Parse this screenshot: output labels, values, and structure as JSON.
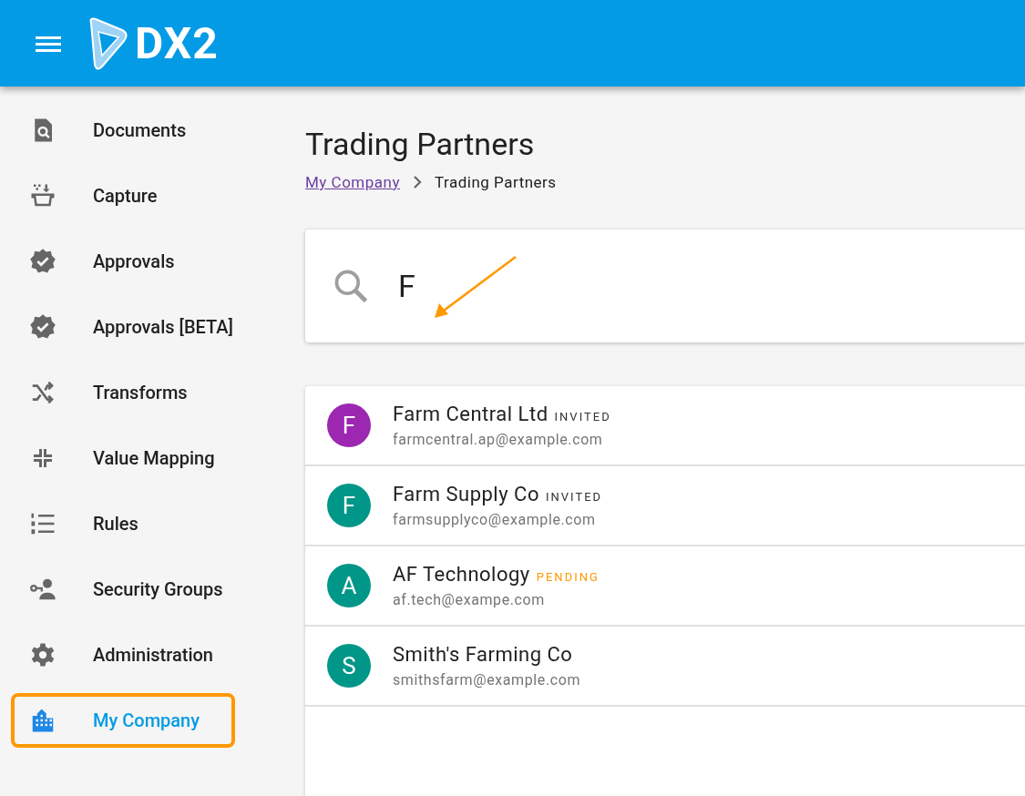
{
  "header": {
    "logo_text": "DX2"
  },
  "sidebar": {
    "items": [
      {
        "label": "Documents",
        "selected": false
      },
      {
        "label": "Capture",
        "selected": false
      },
      {
        "label": "Approvals",
        "selected": false
      },
      {
        "label": "Approvals [BETA]",
        "selected": false
      },
      {
        "label": "Transforms",
        "selected": false
      },
      {
        "label": "Value Mapping",
        "selected": false
      },
      {
        "label": "Rules",
        "selected": false
      },
      {
        "label": "Security Groups",
        "selected": false
      },
      {
        "label": "Administration",
        "selected": false
      },
      {
        "label": "My Company",
        "selected": true
      }
    ]
  },
  "page": {
    "title": "Trading Partners",
    "breadcrumb": [
      {
        "label": "My Company",
        "kind": "link"
      },
      {
        "label": "Trading Partners",
        "kind": "current"
      }
    ]
  },
  "search": {
    "value": "F"
  },
  "partners": [
    {
      "initial": "F",
      "color": "#9c27b0",
      "name": "Farm Central Ltd",
      "status": "INVITED",
      "kind": "invited",
      "email": "farmcentral.ap@example.com"
    },
    {
      "initial": "F",
      "color": "#009688",
      "name": "Farm Supply Co",
      "status": "INVITED",
      "kind": "invited",
      "email": "farmsupplyco@example.com"
    },
    {
      "initial": "A",
      "color": "#009688",
      "name": "AF Technology",
      "status": "PENDING",
      "kind": "pending",
      "email": "af.tech@exampe.com"
    },
    {
      "initial": "S",
      "color": "#009688",
      "name": "Smith's Farming Co",
      "email": "smithsfarm@example.com"
    }
  ]
}
